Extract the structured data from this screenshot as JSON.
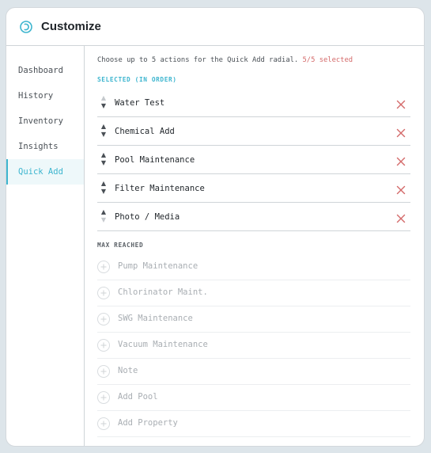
{
  "header": {
    "title": "Customize",
    "icon": "circular-refresh-icon"
  },
  "sidebar": {
    "items": [
      {
        "label": "Dashboard",
        "active": false
      },
      {
        "label": "History",
        "active": false
      },
      {
        "label": "Inventory",
        "active": false
      },
      {
        "label": "Insights",
        "active": false
      },
      {
        "label": "Quick Add",
        "active": true
      }
    ]
  },
  "content": {
    "intro": "Choose up to 5 actions for the Quick Add radial.",
    "count": "5/5 selected",
    "selected_label": "SELECTED (IN ORDER)",
    "selected": [
      {
        "label": "Water Test",
        "up_disabled": true,
        "down_disabled": false
      },
      {
        "label": "Chemical Add",
        "up_disabled": false,
        "down_disabled": false
      },
      {
        "label": "Pool Maintenance",
        "up_disabled": false,
        "down_disabled": false
      },
      {
        "label": "Filter Maintenance",
        "up_disabled": false,
        "down_disabled": false
      },
      {
        "label": "Photo / Media",
        "up_disabled": false,
        "down_disabled": true
      }
    ],
    "max_label": "MAX REACHED",
    "available": [
      {
        "label": "Pump Maintenance"
      },
      {
        "label": "Chlorinator Maint."
      },
      {
        "label": "SWG Maintenance"
      },
      {
        "label": "Vacuum Maintenance"
      },
      {
        "label": "Note"
      },
      {
        "label": "Add Pool"
      },
      {
        "label": "Add Property"
      }
    ]
  },
  "colors": {
    "accent": "#3db5cf",
    "remove": "#d46a6a",
    "count": "#d46a6a",
    "disabled_text": "#a9aeb3"
  }
}
